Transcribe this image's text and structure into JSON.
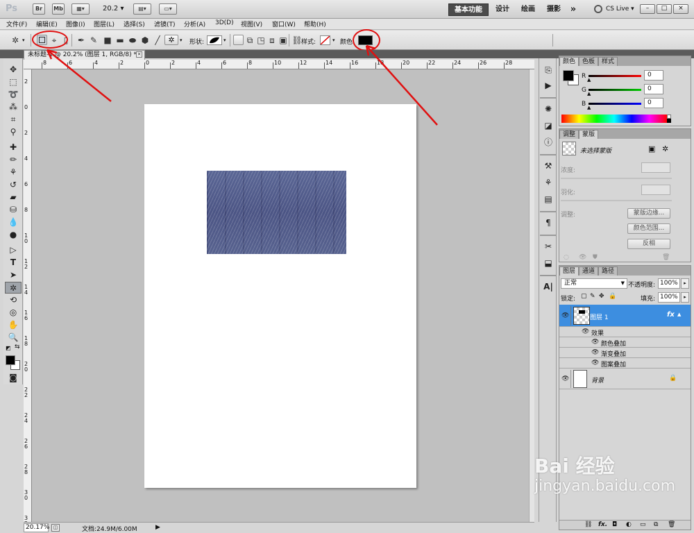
{
  "appbar": {
    "logo": "Ps",
    "bridge_label": "Br",
    "minibridge_label": "Mb",
    "zoom_value": "20.2",
    "workspaces": [
      "基本功能",
      "设计",
      "绘画",
      "摄影"
    ],
    "more": "»",
    "cslive": "CS Live",
    "win_controls": [
      "–",
      "□",
      "×"
    ]
  },
  "menubar": {
    "items": [
      "文件(F)",
      "编辑(E)",
      "图像(I)",
      "图层(L)",
      "选择(S)",
      "滤镜(T)",
      "分析(A)",
      "3D(D)",
      "视图(V)",
      "窗口(W)",
      "帮助(H)"
    ]
  },
  "options": {
    "shape_label": "形状:",
    "style_label": "样式:",
    "color_label": "颜色:",
    "color_value": "#000000"
  },
  "document": {
    "tab_title": "未标题-1 @ 20.2% (图层 1, RGB/8) *",
    "close": "×",
    "top_ruler": [
      "8",
      "6",
      "4",
      "2",
      "0",
      "2",
      "4",
      "6",
      "8",
      "10",
      "12",
      "14",
      "16",
      "18",
      "20",
      "22",
      "24",
      "26",
      "28"
    ],
    "left_ruler": [
      "2",
      "0",
      "2",
      "4",
      "6",
      "8",
      "1 0",
      "1 2",
      "1 4",
      "1 6",
      "1 8",
      "2 0",
      "2 2",
      "2 4",
      "2 6",
      "2 8",
      "3 0",
      "3 2"
    ],
    "pattern_colors": [
      "#5a6695",
      "#4c5585"
    ]
  },
  "status": {
    "zoom": "20.17%",
    "doc_size": "文档:24.9M/6.00M"
  },
  "color_panel": {
    "tabs": [
      "颜色",
      "色板",
      "样式"
    ],
    "channels": [
      {
        "label": "R",
        "value": "0",
        "color": "#cc0000"
      },
      {
        "label": "G",
        "value": "0",
        "color": "#00aa00"
      },
      {
        "label": "B",
        "value": "0",
        "color": "#0000cc"
      }
    ]
  },
  "mask_panel": {
    "tabs": [
      "调整",
      "蒙版"
    ],
    "no_mask": "未选择蒙版",
    "density": "浓度:",
    "feather": "羽化:",
    "refine": "调整:",
    "mask_edge": "蒙版边缘...",
    "color_range": "颜色范围...",
    "invert": "反相"
  },
  "layers_panel": {
    "tabs": [
      "图层",
      "通道",
      "路径"
    ],
    "blend_mode": "正常",
    "opacity_label": "不透明度:",
    "opacity_value": "100%",
    "lock_label": "锁定:",
    "fill_label": "填充:",
    "fill_value": "100%",
    "layers": [
      {
        "name": "图层 1",
        "fx": "fx",
        "selected": true
      },
      {
        "name": "背景",
        "selected": false
      }
    ],
    "effects_label": "效果",
    "effects": [
      "颜色叠加",
      "渐变叠加",
      "图案叠加"
    ]
  },
  "watermark": {
    "brand": "Bai 经验",
    "url": "jingyan.baidu.com"
  }
}
